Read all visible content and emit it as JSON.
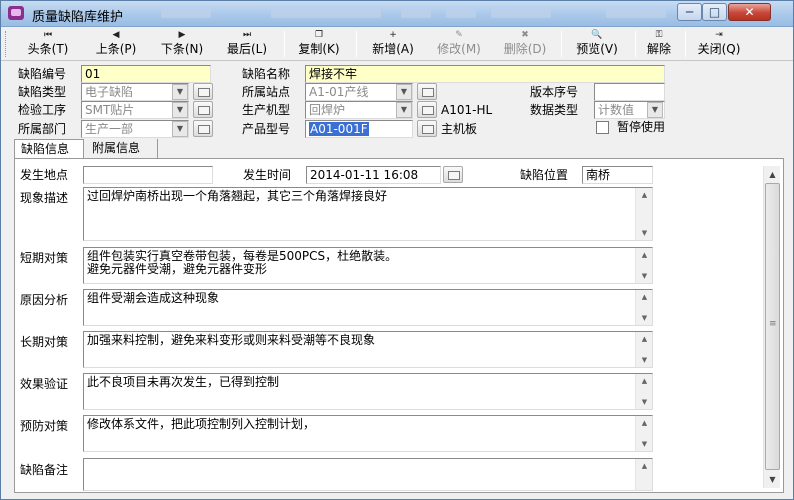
{
  "window": {
    "title": "质量缺陷库维护",
    "minimize": "─",
    "maximize": "□",
    "close": "✕"
  },
  "toolbar": {
    "first": {
      "label": "头条(T)",
      "icon": "first-record-icon",
      "glyph": "⏮"
    },
    "prev": {
      "label": "上条(P)",
      "icon": "prev-record-icon",
      "glyph": "◀"
    },
    "next": {
      "label": "下条(N)",
      "icon": "next-record-icon",
      "glyph": "▶"
    },
    "last": {
      "label": "最后(L)",
      "icon": "last-record-icon",
      "glyph": "⏭"
    },
    "copy": {
      "label": "复制(K)",
      "icon": "copy-icon",
      "glyph": "❐"
    },
    "add": {
      "label": "新增(A)",
      "icon": "add-icon",
      "glyph": "+"
    },
    "edit": {
      "label": "修改(M)",
      "icon": "edit-icon",
      "glyph": "✎"
    },
    "delete": {
      "label": "删除(D)",
      "icon": "delete-icon",
      "glyph": "✖"
    },
    "preview": {
      "label": "预览(V)",
      "icon": "preview-icon",
      "glyph": "🔍"
    },
    "unlock": {
      "label": "解除",
      "icon": "unlock-icon",
      "glyph": "⚿"
    },
    "close": {
      "label": "关闭(Q)",
      "icon": "exit-icon",
      "glyph": "⇥"
    }
  },
  "header": {
    "defect_no": {
      "label": "缺陷编号",
      "value": "01"
    },
    "defect_name": {
      "label": "缺陷名称",
      "value": "焊接不牢"
    },
    "defect_type": {
      "label": "缺陷类型",
      "value": "电子缺陷"
    },
    "station": {
      "label": "所属站点",
      "value": "A1-01产线"
    },
    "version_no": {
      "label": "版本序号",
      "value": ""
    },
    "inspect_proc": {
      "label": "检验工序",
      "value": "SMT贴片"
    },
    "machine": {
      "label": "生产机型",
      "value": "回焊炉",
      "extra": "A101-HL"
    },
    "data_type": {
      "label": "数据类型",
      "value": "计数值"
    },
    "department": {
      "label": "所属部门",
      "value": "生产一部"
    },
    "product_model": {
      "label": "产品型号",
      "value": "A01-001F",
      "extra": "主机板"
    },
    "suspend": {
      "label": "暂停使用",
      "checked": false
    }
  },
  "tabs": {
    "info": "缺陷信息",
    "attach": "附属信息"
  },
  "detail": {
    "location": {
      "label": "发生地点",
      "value": ""
    },
    "time": {
      "label": "发生时间",
      "value": "2014-01-11 16:08"
    },
    "position": {
      "label": "缺陷位置",
      "value": "南桥"
    },
    "phenomenon": {
      "label": "现象描述",
      "value": "过回焊炉南桥出现一个角落翘起，其它三个角落焊接良好"
    },
    "short_term": {
      "label": "短期对策",
      "value": "组件包装实行真空卷带包装，每卷是500PCS，杜绝散装。\n避免元器件受潮，避免元器件变形"
    },
    "cause": {
      "label": "原因分析",
      "value": "组件受潮会造成这种现象"
    },
    "long_term": {
      "label": "长期对策",
      "value": "加强来料控制，避免来料变形或则来料受潮等不良现象"
    },
    "verify": {
      "label": "效果验证",
      "value": "此不良项目未再次发生，已得到控制"
    },
    "prevent": {
      "label": "预防对策",
      "value": "修改体系文件，把此项控制列入控制计划，"
    },
    "remark": {
      "label": "缺陷备注",
      "value": ""
    }
  }
}
